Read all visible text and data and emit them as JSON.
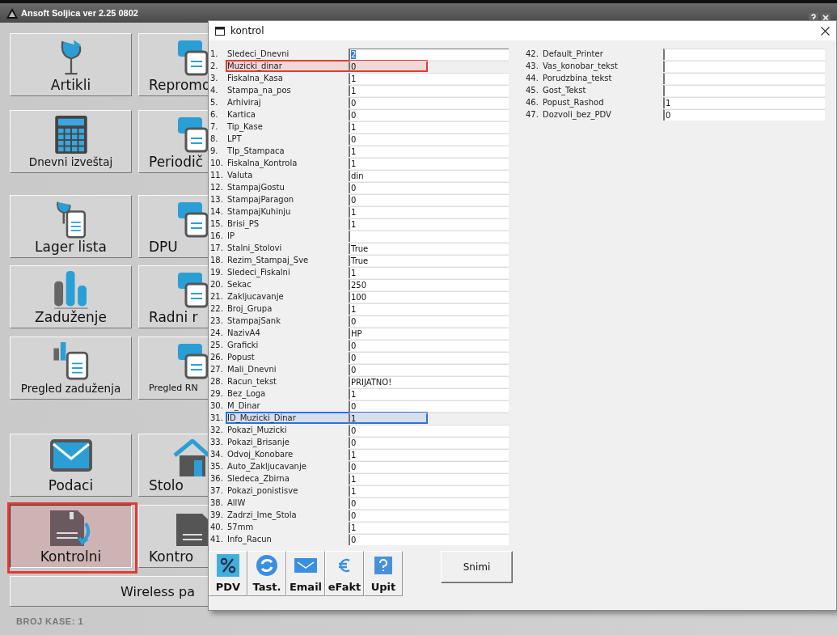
{
  "window": {
    "title": "Ansoft Soljica ver 2.25 0802"
  },
  "launcher_rows": [
    {
      "buttons": [
        {
          "label": "Artikli",
          "selected": false
        },
        {
          "label": "Repromo",
          "selected": false
        }
      ]
    },
    {
      "buttons": [
        {
          "label": "Dnevni izveštaj",
          "selected": false
        },
        {
          "label": "Periodič",
          "selected": false
        }
      ]
    },
    {
      "buttons": [
        {
          "label": "Lager lista",
          "selected": false
        },
        {
          "label": "DPU",
          "selected": false
        }
      ]
    },
    {
      "buttons": [
        {
          "label": "Zaduženje",
          "selected": false
        },
        {
          "label": "Radni r",
          "selected": false
        }
      ]
    },
    {
      "buttons": [
        {
          "label": "Pregled zaduženja",
          "selected": false
        },
        {
          "label": "Pregled RN",
          "selected": false
        }
      ]
    },
    {
      "buttons": [
        {
          "label": "Podaci",
          "selected": false
        },
        {
          "label": "Stolo",
          "selected": false
        }
      ]
    },
    {
      "buttons": [
        {
          "label": "Kontrolni",
          "selected": true,
          "color": "#e53935"
        },
        {
          "label": "Kontro",
          "selected": false
        }
      ]
    }
  ],
  "wide_button": {
    "label": "Wireless pa"
  },
  "status_bar": "BROJ KASE: 1",
  "dialog": {
    "title": "kontrol",
    "left_settings": [
      {
        "number": "1.",
        "name": "Sledeci_Dnevni",
        "value": "2",
        "selected": true
      },
      {
        "number": "2.",
        "name": "Muzicki_dinar",
        "value": "0",
        "selected": false,
        "color": "#e53935"
      },
      {
        "number": "3.",
        "name": "Fiskalna_Kasa",
        "value": "1",
        "selected": false
      },
      {
        "number": "4.",
        "name": "Stampa_na_pos",
        "value": "1",
        "selected": false
      },
      {
        "number": "5.",
        "name": "Arhiviraj",
        "value": "0",
        "selected": false
      },
      {
        "number": "6.",
        "name": "Kartica",
        "value": "0",
        "selected": false
      },
      {
        "number": "7.",
        "name": "Tip_Kase",
        "value": "1",
        "selected": false
      },
      {
        "number": "8.",
        "name": "LPT",
        "value": "0",
        "selected": false
      },
      {
        "number": "9.",
        "name": "TIp_Stampaca",
        "value": "1",
        "selected": false
      },
      {
        "number": "10.",
        "name": "Fiskalna_Kontrola",
        "value": "1",
        "selected": false
      },
      {
        "number": "11.",
        "name": "Valuta",
        "value": "din",
        "selected": false
      },
      {
        "number": "12.",
        "name": "StampajGostu",
        "value": "0",
        "selected": false
      },
      {
        "number": "13.",
        "name": "StampajParagon",
        "value": "0",
        "selected": false
      },
      {
        "number": "14.",
        "name": "StampajKuhinju",
        "value": "1",
        "selected": false
      },
      {
        "number": "15.",
        "name": "Brisi_PS",
        "value": "1",
        "selected": false
      },
      {
        "number": "16.",
        "name": "IP",
        "selected": false
      },
      {
        "number": "17.",
        "name": "Stalni_Stolovi",
        "value": "True",
        "selected": false
      },
      {
        "number": "18.",
        "name": "Rezim_Stampaj_Sve",
        "value": "True",
        "selected": false
      },
      {
        "number": "19.",
        "name": "Sledeci_Fiskalni",
        "value": "1",
        "selected": false
      },
      {
        "number": "20.",
        "name": "Sekac",
        "value": "250",
        "selected": false
      },
      {
        "number": "21.",
        "name": "Zakljucavanje",
        "value": "100",
        "selected": false
      },
      {
        "number": "22.",
        "name": "Broj_Grupa",
        "value": "1",
        "selected": false
      },
      {
        "number": "23.",
        "name": "StampajSank",
        "value": "0",
        "selected": false
      },
      {
        "number": "24.",
        "name": "NazivA4",
        "value": "HP",
        "selected": false
      },
      {
        "number": "25.",
        "name": "Graficki",
        "value": "0",
        "selected": false
      },
      {
        "number": "26.",
        "name": "Popust",
        "value": "0",
        "selected": false
      },
      {
        "number": "27.",
        "name": "Mali_Dnevni",
        "value": "0",
        "selected": false
      },
      {
        "number": "28.",
        "name": "Racun_tekst",
        "value": "PRIJATNO!",
        "selected": false
      },
      {
        "number": "29.",
        "name": "Bez_Loga",
        "value": "1",
        "selected": false
      },
      {
        "number": "30.",
        "name": "M_Dinar",
        "value": "0",
        "selected": false
      },
      {
        "number": "31.",
        "name": "ID_Muzicki_Dinar",
        "value": "1",
        "selected": false,
        "color": "#2f6fe0"
      },
      {
        "number": "32.",
        "name": "Pokazi_Muzicki",
        "value": "0",
        "selected": false
      },
      {
        "number": "33.",
        "name": "Pokazi_Brisanje",
        "value": "0",
        "selected": false
      },
      {
        "number": "34.",
        "name": "Odvoj_Konobare",
        "value": "1",
        "selected": false
      },
      {
        "number": "35.",
        "name": "Auto_Zakljucavanje",
        "value": "0",
        "selected": false
      },
      {
        "number": "36.",
        "name": "Sledeca_Zbirna",
        "value": "1",
        "selected": false
      },
      {
        "number": "37.",
        "name": "Pokazi_ponistisve",
        "value": "1",
        "selected": false
      },
      {
        "number": "38.",
        "name": "AllW",
        "value": "0",
        "selected": false
      },
      {
        "number": "39.",
        "name": "Zadrzi_Ime_Stola",
        "value": "0",
        "selected": false
      },
      {
        "number": "40.",
        "name": "57mm",
        "value": "1",
        "selected": false
      },
      {
        "number": "41.",
        "name": "Info_Racun",
        "value": "0",
        "selected": false
      }
    ],
    "right_settings": [
      {
        "number": "42.",
        "name": "Default_Printer",
        "selected": false
      },
      {
        "number": "43.",
        "name": "Vas_konobar_tekst",
        "selected": false
      },
      {
        "number": "44.",
        "name": "Porudzbina_tekst",
        "selected": false
      },
      {
        "number": "45.",
        "name": "Gost_Tekst",
        "selected": false
      },
      {
        "number": "46.",
        "name": "Popust_Rashod",
        "value": "1",
        "selected": false
      },
      {
        "number": "47.",
        "name": "Dozvoli_bez_PDV",
        "value": "0",
        "selected": false
      }
    ],
    "toolbar": [
      {
        "label": "PDV",
        "kind": "percent"
      },
      {
        "label": "Tast.",
        "kind": "refresh"
      },
      {
        "label": "Email",
        "kind": "mail"
      },
      {
        "label": "eFakt",
        "kind": "euro"
      },
      {
        "label": "Upit",
        "kind": "help"
      }
    ],
    "save_button": "Snimi"
  }
}
